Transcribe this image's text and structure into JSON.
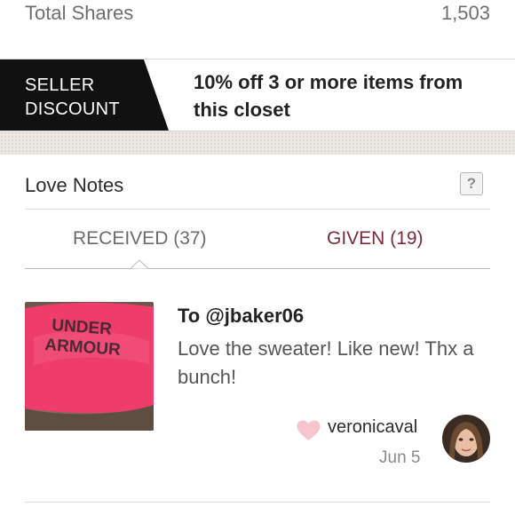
{
  "stats": {
    "total_shares_label": "Total Shares",
    "total_shares_value": "1,503"
  },
  "seller_discount": {
    "tag_line1": "SELLER",
    "tag_line2": "DISCOUNT",
    "text": "10% off 3 or more items from this closet"
  },
  "love_notes": {
    "title": "Love Notes",
    "help_label": "?",
    "tabs": [
      {
        "label": "RECEIVED",
        "count": "(37)",
        "active": true
      },
      {
        "label": "GIVEN",
        "count": "(19)",
        "active": false
      }
    ],
    "notes": [
      {
        "to": "To @jbaker06",
        "message": "Love the sweater! Like new! Thx a bunch!",
        "photo_icon": "pink-sweater-photo",
        "photo_text": "UNDER ARMOUR",
        "heart_icon": "heart-icon",
        "username": "veronicaval",
        "date": "Jun 5"
      }
    ]
  },
  "colors": {
    "accent_given": "#7a2a3a",
    "heart": "#f7c4cf",
    "tag_bg": "#111111"
  }
}
